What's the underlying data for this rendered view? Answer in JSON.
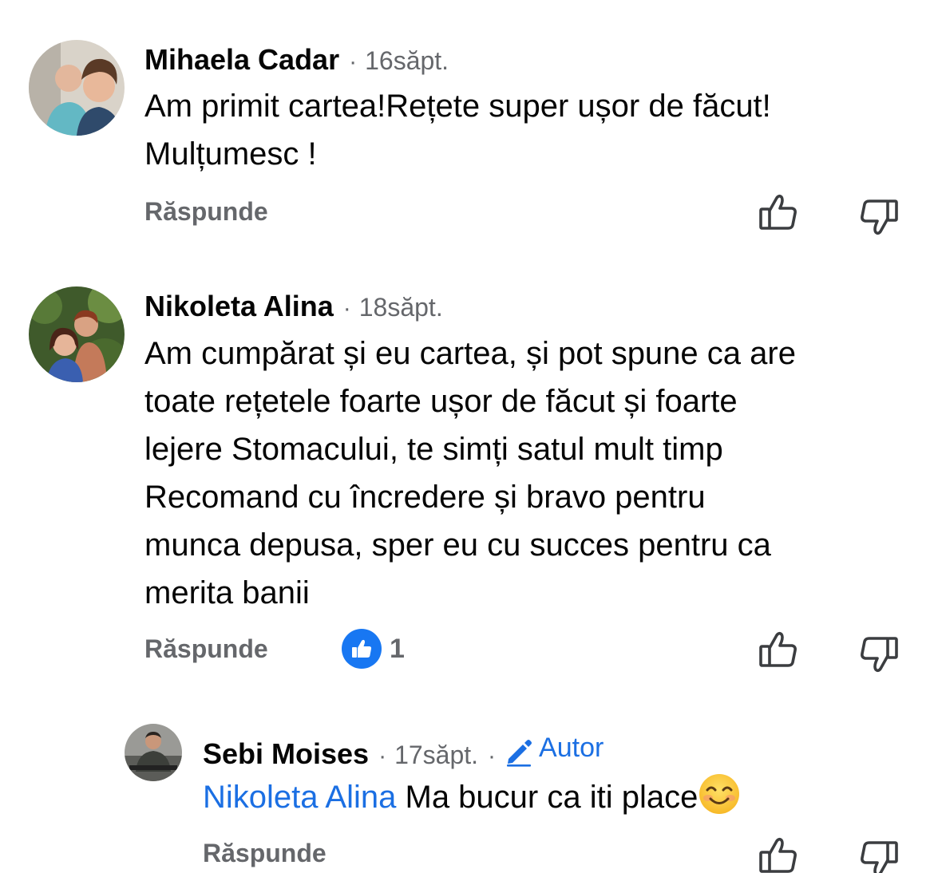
{
  "comments": [
    {
      "author": "Mihaela Cadar",
      "time": "16săpt.",
      "separator": "·",
      "lines": [
        "Am primit cartea!Rețete super ușor de făcut!",
        "Mulțumesc !"
      ],
      "reply_label": "Răspunde",
      "like_icon": "thumbs-up-outline-icon",
      "dislike_icon": "thumbs-down-outline-icon"
    },
    {
      "author": "Nikoleta Alina",
      "time": "18săpt.",
      "separator": "·",
      "lines": [
        "Am cumpărat și eu cartea, și pot spune ca are",
        "toate rețetele foarte ușor de făcut și foarte",
        "lejere Stomacului, te simți satul mult timp",
        "Recomand cu încredere și bravo pentru",
        "munca depusa, sper eu cu succes pentru ca",
        "merita banii"
      ],
      "reply_label": "Răspunde",
      "reaction": {
        "icon": "like-reaction-icon",
        "count": "1",
        "color": "#1877f2"
      }
    },
    {
      "author": "Sebi Moises",
      "time": "17săpt.",
      "separator": "·",
      "separator2": "·",
      "badge": {
        "icon": "pencil-icon",
        "label": "Autor",
        "color": "#1b6fe3"
      },
      "mention": "Nikoleta Alina",
      "text": "Ma bucur ca iti place",
      "emoji": "smiling-face-emoji",
      "reply_label": "Răspunde"
    }
  ],
  "colors": {
    "text": "#050505",
    "muted": "#65676b",
    "link": "#1b6fe3"
  }
}
